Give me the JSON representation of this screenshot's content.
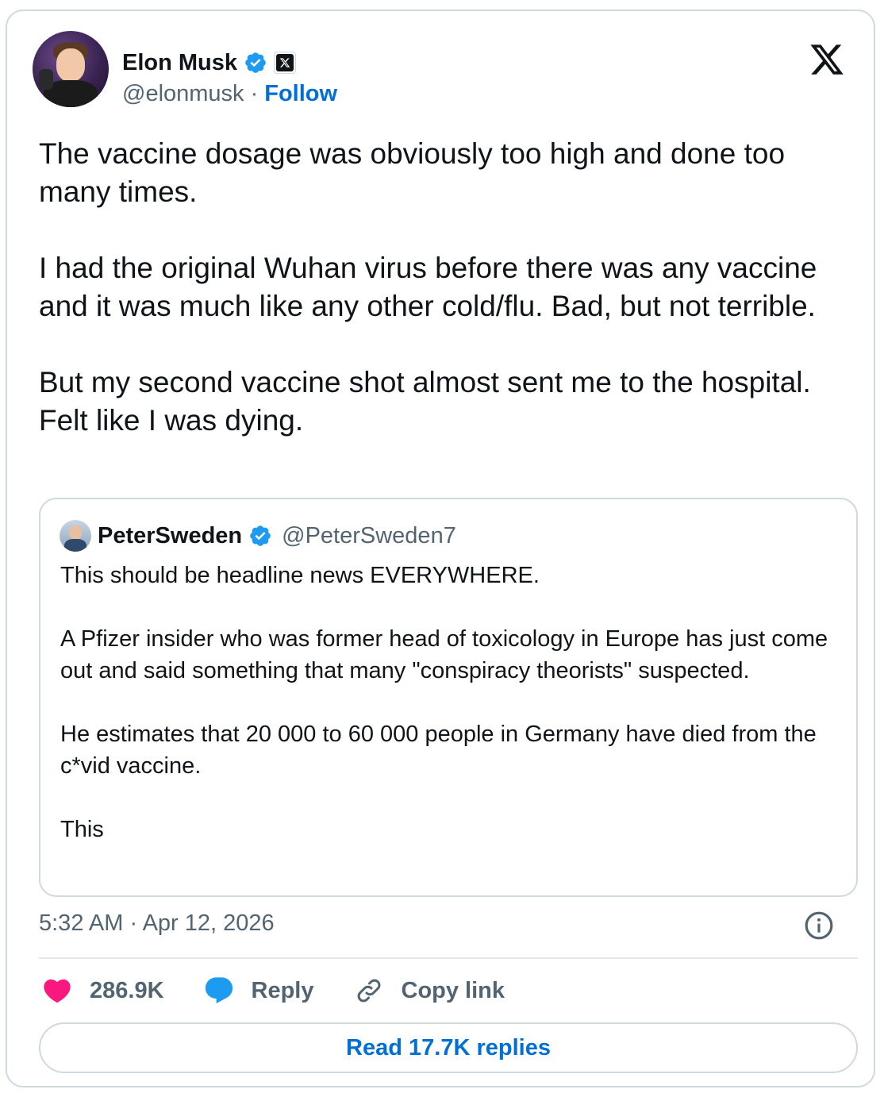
{
  "author": {
    "name": "Elon Musk",
    "handle": "@elonmusk",
    "separator": "·",
    "follow_label": "Follow"
  },
  "tweet": {
    "text": "The vaccine dosage was obviously too high and done too many times.\n\nI had the original Wuhan virus before there was any vaccine and it was much like any other cold/flu. Bad, but not terrible.\n\nBut my second vaccine shot almost sent me to the hospital. Felt like I was dying."
  },
  "quoted": {
    "name": "PeterSweden",
    "handle": "@PeterSweden7",
    "text": "This should be headline news EVERYWHERE.\n\nA Pfizer insider who was former head of toxicology in Europe has just come out and said something that many \"conspiracy theorists\" suspected.\n\nHe estimates that 20 000 to 60 000 people in Germany have died from the c*vid vaccine.\n\nThis"
  },
  "timestamp": "5:32 AM · Apr 12, 2026",
  "actions": {
    "likes": "286.9K",
    "reply_label": "Reply",
    "copy_link_label": "Copy link"
  },
  "read_replies_label": "Read 17.7K replies",
  "icons": [
    "verified-badge-icon",
    "x-affiliate-icon",
    "x-logo-icon",
    "info-icon",
    "heart-icon",
    "reply-bubble-icon",
    "link-icon"
  ],
  "colors": {
    "link_blue": "#006fd6",
    "verified_blue": "#1d9bf0",
    "heart_pink": "#f91880",
    "muted_text": "#536471",
    "border": "#cfd9de"
  }
}
